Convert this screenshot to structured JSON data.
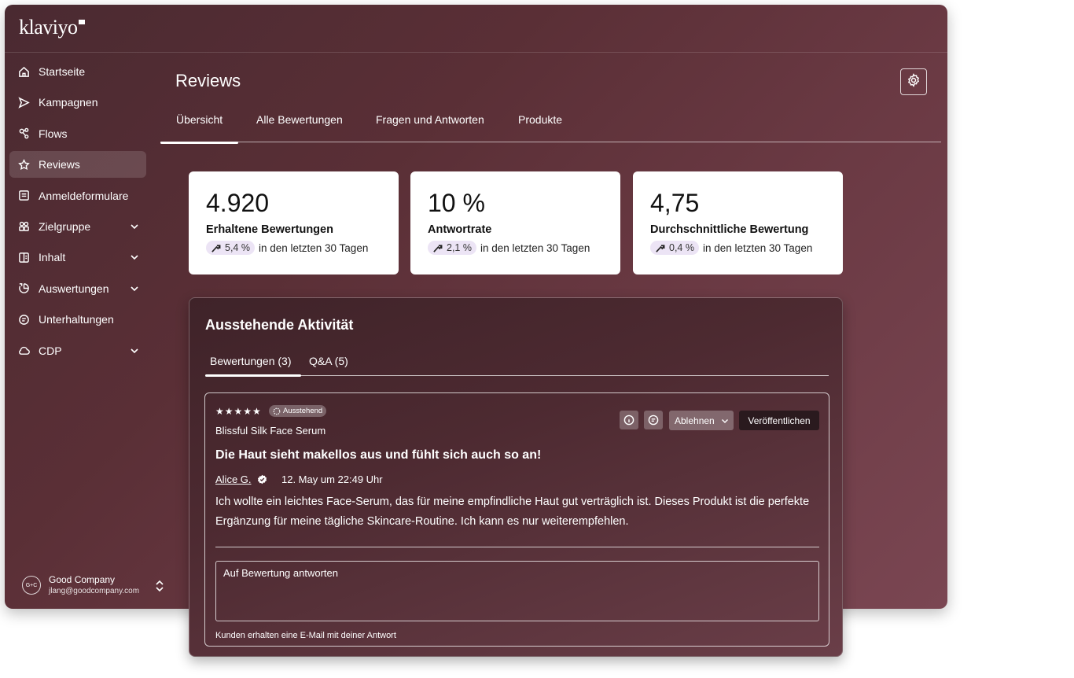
{
  "app": {
    "logo": "klaviyo"
  },
  "sidebar": {
    "items": [
      {
        "label": "Startseite",
        "icon": "home-icon",
        "expandable": false
      },
      {
        "label": "Kampagnen",
        "icon": "send-icon",
        "expandable": false
      },
      {
        "label": "Flows",
        "icon": "flows-icon",
        "expandable": false
      },
      {
        "label": "Reviews",
        "icon": "star-icon",
        "expandable": false,
        "active": true
      },
      {
        "label": "Anmeldeformulare",
        "icon": "form-icon",
        "expandable": false
      },
      {
        "label": "Zielgruppe",
        "icon": "audience-icon",
        "expandable": true
      },
      {
        "label": "Inhalt",
        "icon": "content-icon",
        "expandable": true
      },
      {
        "label": "Auswertungen",
        "icon": "analytics-icon",
        "expandable": true
      },
      {
        "label": "Unterhaltungen",
        "icon": "chat-icon",
        "expandable": false
      },
      {
        "label": "CDP",
        "icon": "cloud-icon",
        "expandable": true
      }
    ]
  },
  "account": {
    "avatar": "G+C",
    "name": "Good Company",
    "email": "jlang@goodcompany.com"
  },
  "header": {
    "title": "Reviews"
  },
  "tabs": [
    {
      "label": "Übersicht",
      "active": true
    },
    {
      "label": "Alle Bewertungen",
      "active": false
    },
    {
      "label": "Fragen und Antworten",
      "active": false
    },
    {
      "label": "Produkte",
      "active": false
    }
  ],
  "stats": [
    {
      "value": "4.920",
      "label": "Erhaltene Bewertungen",
      "change": "5,4 %",
      "period": "in den letzten 30 Tagen"
    },
    {
      "value": "10 %",
      "label": "Antwortrate",
      "change": "2,1 %",
      "period": "in den letzten 30 Tagen"
    },
    {
      "value": "4,75",
      "label": "Durchschnittliche Bewertung",
      "change": "0,4 %",
      "period": "in den letzten 30 Tagen"
    }
  ],
  "pending": {
    "title": "Ausstehende Aktivität",
    "tabs": [
      {
        "label": "Bewertungen (3)",
        "active": true
      },
      {
        "label": "Q&A (5)",
        "active": false
      }
    ],
    "review": {
      "stars": "★★★★★",
      "rating": 5,
      "status": "Ausstehend",
      "product": "Blissful Silk Face Serum",
      "title": "Die Haut sieht makellos aus und fühlt sich auch so an!",
      "author": "Alice G.",
      "date": "12. May um 22:49 Uhr",
      "body": "Ich wollte ein leichtes Face-Serum, das für meine empfindliche Haut gut verträglich ist. Dieses Produkt ist die perfekte Ergänzung für meine tägliche Skincare-Routine. Ich kann es nur weiterempfehlen.",
      "decline_label": "Ablehnen",
      "publish_label": "Veröffentlichen",
      "reply_placeholder": "Auf Bewertung antworten",
      "reply_hint": "Kunden erhalten eine E-Mail mit deiner Antwort"
    }
  }
}
